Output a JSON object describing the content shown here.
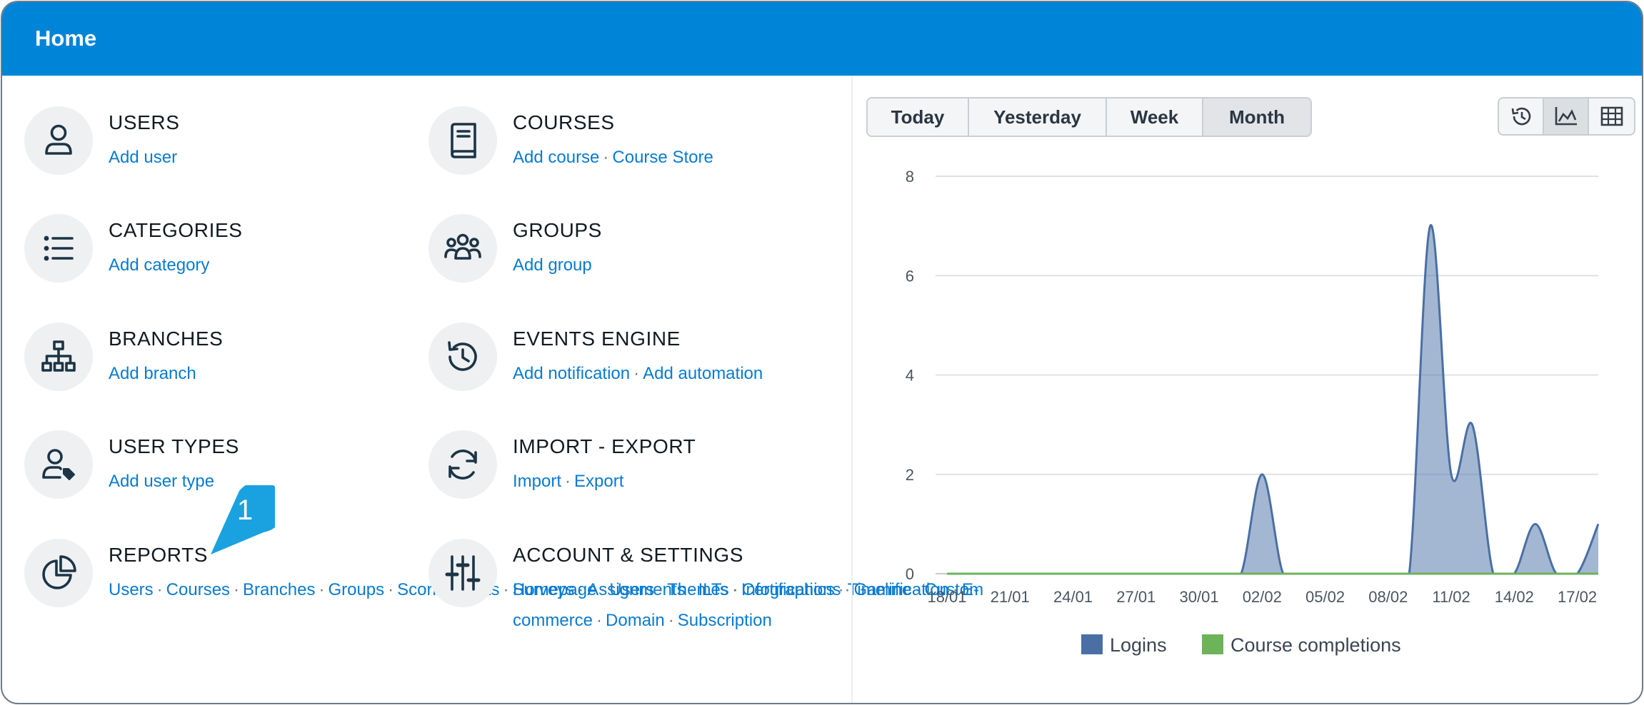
{
  "window": {
    "title": "Home"
  },
  "sections": [
    {
      "id": "users",
      "title": "USERS",
      "icon": "user-icon",
      "links": [
        "Add user"
      ]
    },
    {
      "id": "categories",
      "title": "CATEGORIES",
      "icon": "list-icon",
      "links": [
        "Add category"
      ]
    },
    {
      "id": "branches",
      "title": "BRANCHES",
      "icon": "sitemap-icon",
      "links": [
        "Add branch"
      ]
    },
    {
      "id": "user-types",
      "title": "USER TYPES",
      "icon": "user-tag-icon",
      "links": [
        "Add user type"
      ]
    },
    {
      "id": "reports",
      "title": "REPORTS",
      "icon": "pie-chart-icon",
      "links": [
        "Users",
        "Courses",
        "Branches",
        "Groups",
        "Scorm",
        "Tests",
        "Surveys",
        "Assignments",
        "ILTs",
        "Infographics",
        "Timeline",
        "Custom"
      ]
    },
    {
      "id": "courses",
      "title": "COURSES",
      "icon": "book-icon",
      "links": [
        "Add course",
        "Course Store"
      ]
    },
    {
      "id": "groups",
      "title": "GROUPS",
      "icon": "group-icon",
      "links": [
        "Add group"
      ]
    },
    {
      "id": "events-engine",
      "title": "EVENTS ENGINE",
      "icon": "history-icon",
      "links": [
        "Add notification",
        "Add automation"
      ]
    },
    {
      "id": "import-export",
      "title": "IMPORT - EXPORT",
      "icon": "sync-icon",
      "links": [
        "Import",
        "Export"
      ]
    },
    {
      "id": "account-settings",
      "title": "ACCOUNT & SETTINGS",
      "icon": "sliders-icon",
      "links": [
        "Homepage",
        "Users",
        "Themes",
        "Certifications",
        "Gamification",
        "E-commerce",
        "Domain",
        "Subscription"
      ]
    }
  ],
  "callout": {
    "label": "1"
  },
  "period_tabs": [
    "Today",
    "Yesterday",
    "Week",
    "Month"
  ],
  "view_buttons": [
    {
      "icon": "history-icon",
      "active": false
    },
    {
      "icon": "area-chart-icon",
      "active": true
    },
    {
      "icon": "table-icon",
      "active": false
    }
  ],
  "colors": {
    "header": "#0084d8",
    "link": "#0a7bd0",
    "logins": "#4a6fa5",
    "completions": "#6cb35a"
  },
  "chart_data": {
    "type": "area",
    "title": "",
    "xlabel": "",
    "ylabel": "",
    "ylim": [
      0,
      8
    ],
    "yticks": [
      "0",
      "2",
      "4",
      "6",
      "8"
    ],
    "x_labels": [
      "18/01",
      "21/01",
      "24/01",
      "27/01",
      "30/01",
      "02/02",
      "05/02",
      "08/02",
      "11/02",
      "14/02",
      "17/02"
    ],
    "x": [
      "18/01",
      "19/01",
      "20/01",
      "21/01",
      "22/01",
      "23/01",
      "24/01",
      "25/01",
      "26/01",
      "27/01",
      "28/01",
      "29/01",
      "30/01",
      "31/01",
      "01/02",
      "02/02",
      "03/02",
      "04/02",
      "05/02",
      "06/02",
      "07/02",
      "08/02",
      "09/02",
      "10/02",
      "11/02",
      "12/02",
      "13/02",
      "14/02",
      "15/02",
      "16/02",
      "17/02",
      "18/02"
    ],
    "series": [
      {
        "name": "Logins",
        "color": "#4a6fa5",
        "values": [
          0,
          0,
          0,
          0,
          0,
          0,
          0,
          0,
          0,
          0,
          0,
          0,
          0,
          0,
          0,
          2,
          0,
          0,
          0,
          0,
          0,
          0,
          0,
          7,
          2,
          3,
          0,
          0,
          1,
          0,
          0,
          1
        ]
      },
      {
        "name": "Course completions",
        "color": "#6cb35a",
        "values": [
          0,
          0,
          0,
          0,
          0,
          0,
          0,
          0,
          0,
          0,
          0,
          0,
          0,
          0,
          0,
          0,
          0,
          0,
          0,
          0,
          0,
          0,
          0,
          0,
          0,
          0,
          0,
          0,
          0,
          0,
          0,
          0
        ]
      }
    ],
    "grid": true,
    "legend": "bottom"
  }
}
